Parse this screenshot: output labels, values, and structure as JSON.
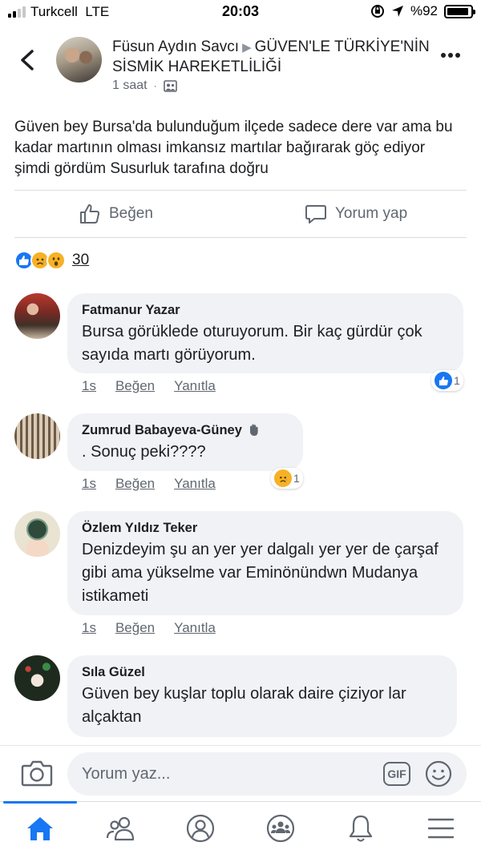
{
  "status_bar": {
    "carrier": "Turkcell",
    "network": "LTE",
    "time": "20:03",
    "battery": "%92",
    "battery_level": 0.92
  },
  "post": {
    "author": "Füsun Aydın Savcı",
    "group": "GÜVEN'LE TÜRKİYE'NİN  SİSMİK HAREKETLİLİĞİ",
    "time_ago": "1 saat",
    "body": "Güven bey Bursa'da bulunduğum ilçede sadece dere var ama bu kadar martının olması imkansız  martılar bağırarak göç ediyor şimdi gördüm Susurluk tarafına doğru",
    "like_label": "Beğen",
    "comment_label": "Yorum yap",
    "reaction_icons": [
      "like-icon",
      "sad-icon",
      "wow-icon"
    ],
    "reactions_count": "30"
  },
  "comments": [
    {
      "name": "Fatmanur Yazar",
      "text": "Bursa görüklede oturuyorum. Bir kaç gürdür çok sayıda martı görüyorum.",
      "time": "1s",
      "like_label": "Beğen",
      "reply_label": "Yanıtla",
      "reaction_icon": "like-icon",
      "reaction_count": "1"
    },
    {
      "name": "Zumrud Babayeva-Güney",
      "badge_icon": "wave-hand-icon",
      "text": ". Sonuç peki????",
      "time": "1s",
      "like_label": "Beğen",
      "reply_label": "Yanıtla",
      "reaction_icon": "sad-icon",
      "reaction_count": "1"
    },
    {
      "name": "Özlem Yıldız Teker",
      "text": "Denizdeyim şu an yer yer dalgalı yer yer de çarşaf gibi ama yükselme var Eminönündwn Mudanya istikameti",
      "time": "1s",
      "like_label": "Beğen",
      "reply_label": "Yanıtla"
    },
    {
      "name": "Sıla Güzel",
      "text": "Güven bey kuşlar toplu olarak daire  çiziyor lar alçaktan"
    }
  ],
  "composer": {
    "placeholder": "Yorum yaz...",
    "gif_label": "GIF"
  },
  "tabs": [
    "home-icon",
    "friends-icon",
    "profile-icon",
    "groups-icon",
    "notifications-icon",
    "menu-icon"
  ],
  "colors": {
    "accent": "#1877f2",
    "bubble": "#f0f2f5",
    "secondary_text": "#606770",
    "reaction_yellow": "#f7b125"
  }
}
